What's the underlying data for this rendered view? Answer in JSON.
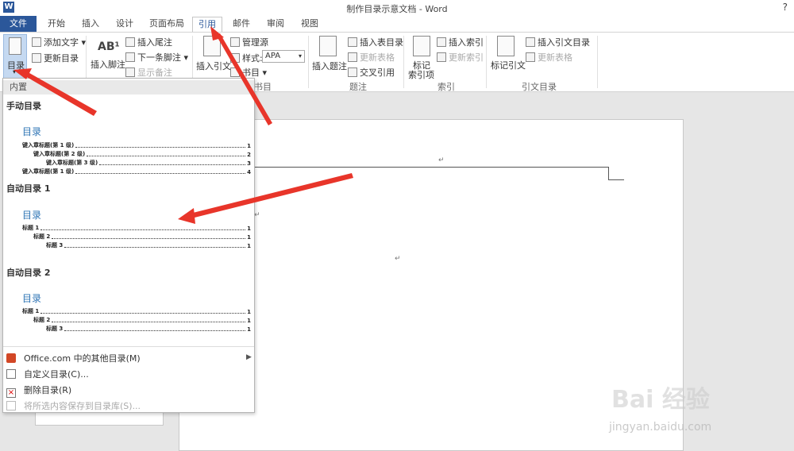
{
  "window": {
    "title": "制作目录示意文档 - Word",
    "help": "?"
  },
  "tabs": [
    "文件",
    "开始",
    "插入",
    "设计",
    "页面布局",
    "引用",
    "邮件",
    "审阅",
    "视图"
  ],
  "active_tab": "引用",
  "ribbon": {
    "toc": {
      "big": "目录",
      "add_text": "添加文字 ▾",
      "update": "更新目录"
    },
    "footnotes": {
      "insert_footnote": "插入脚注",
      "insert_endnote": "插入尾注",
      "next_footnote": "下一条脚注 ▾",
      "show_notes": "显示备注"
    },
    "citations": {
      "insert_citation": "插入引文",
      "manage_sources": "管理源",
      "style_label": "样式:",
      "style_value": "APA",
      "bibliography": "书目 ▾",
      "group_label": "书目"
    },
    "captions": {
      "insert_caption": "插入题注",
      "insert_table_of_figures": "插入表目录",
      "update_table": "更新表格",
      "cross_reference": "交叉引用",
      "group_label": "题注"
    },
    "index": {
      "mark_entry": "标记",
      "mark_entry2": "索引项",
      "insert_index": "插入索引",
      "update_index": "更新索引",
      "group_label": "索引"
    },
    "toa": {
      "mark_citation": "标记引文",
      "insert_toa": "插入引文目录",
      "update_table": "更新表格",
      "group_label": "引文目录"
    }
  },
  "dropdown": {
    "header": "内置",
    "sections": [
      {
        "name": "手动目录",
        "title": "目录",
        "lines": [
          "键入章标题(第 1 级)",
          "键入章标题(第 2 级)",
          "键入章标题(第 3 级)",
          "键入章标题(第 1 级)"
        ],
        "pages": [
          "1",
          "2",
          "3",
          "4"
        ]
      },
      {
        "name": "自动目录 1",
        "title": "目录",
        "lines": [
          "标题 1",
          "标题 2",
          "标题 3"
        ],
        "pages": [
          "1",
          "1",
          "1"
        ]
      },
      {
        "name": "自动目录 2",
        "title": "目录",
        "lines": [
          "标题 1",
          "标题 2",
          "标题 3"
        ],
        "pages": [
          "1",
          "1",
          "1"
        ]
      }
    ],
    "menu": {
      "more_office": "Office.com 中的其他目录(M)",
      "custom": "自定义目录(C)...",
      "delete": "删除目录(R)",
      "save": "将所选内容保存到目录库(S)..."
    }
  },
  "document": {
    "para_mark": "↵"
  },
  "watermark": {
    "logo": "Bai 经验",
    "url": "jingyan.baidu.com"
  },
  "colors": {
    "accent": "#2b579a",
    "toc_title": "#2e74b5",
    "arrow": "#e8352a"
  }
}
